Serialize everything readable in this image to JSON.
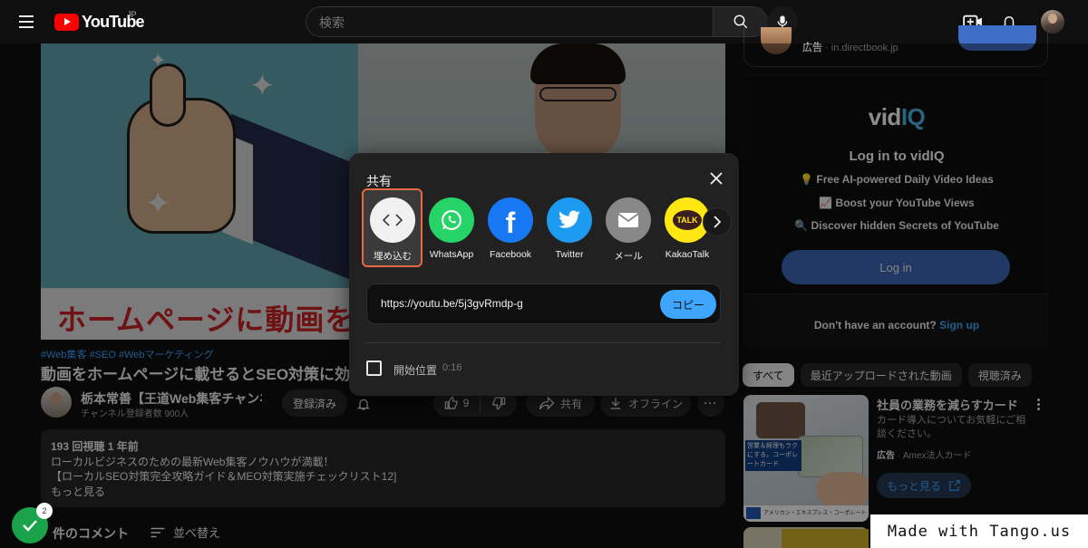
{
  "header": {
    "logo_text": "YouTube",
    "logo_region": "JP",
    "search_placeholder": "検索"
  },
  "video": {
    "banner_text": "ホームページに動画を載せる",
    "hashtags": "#Web集客 #SEO #Webマーケティング",
    "title": "動画をホームページに載せるとSEO対策に効果",
    "channel_name": "栃本常善【王道Web集客チャンネル】",
    "subscribers": "チャンネル登録者数 900人",
    "subscribed_label": "登録済み",
    "like_count": "9",
    "share_label": "共有",
    "offline_label": "オフライン"
  },
  "description": {
    "stats": "193 回視聴  1 年前",
    "line1": "ローカルビジネスのための最新Web集客ノウハウが満載！",
    "line2": "【ローカルSEO対策完全攻略ガイド＆MEO対策実施チェックリスト12]",
    "more": "もっと見る"
  },
  "comments": {
    "count_label": "件のコメント",
    "sort_label": "並べ替え"
  },
  "tango": {
    "badge_count": "2",
    "watermark": "Made with Tango.us"
  },
  "ad_top": {
    "label": "広告",
    "domain": "in.directbook.jp"
  },
  "vidiq": {
    "brand_main": "vid",
    "brand_accent": "IQ",
    "title": "Log in to vidIQ",
    "features": [
      "💡 Free AI-powered Daily Video Ideas",
      "📈 Boost your YouTube Views",
      "🔍 Discover hidden Secrets of YouTube"
    ],
    "login_label": "Log in",
    "no_account": "Don't have an account?",
    "signup": "Sign up"
  },
  "chips": [
    "すべて",
    "最近アップロードされた動画",
    "視聴済み"
  ],
  "ad_side": {
    "title": "社員の業務を減らすカード",
    "desc": "カード導入についてお気軽にご相談ください。",
    "label": "広告",
    "advertiser": "Amex法人カード",
    "cta": "もっと見る",
    "thumb_tag": "営業＆経理もラクにする。コーポレートカード",
    "thumb_footer": "アメリカン・エキスプレス・コーポレート・カード [お気軽にご相談]"
  },
  "share_dialog": {
    "title": "共有",
    "targets": [
      {
        "label": "埋め込む",
        "icon": "embed-icon",
        "color": "#f1f1f1"
      },
      {
        "label": "WhatsApp",
        "icon": "whatsapp-icon",
        "color": "#25d366"
      },
      {
        "label": "Facebook",
        "icon": "facebook-icon",
        "color": "#1877f2"
      },
      {
        "label": "Twitter",
        "icon": "twitter-icon",
        "color": "#1d9bf0"
      },
      {
        "label": "メール",
        "icon": "mail-icon",
        "color": "#888888"
      },
      {
        "label": "KakaoTalk",
        "icon": "kakaotalk-icon",
        "color": "#ffe812"
      }
    ],
    "url": "https://youtu.be/5j3gvRmdp-g",
    "copy_label": "コピー",
    "start_label": "開始位置",
    "start_time": "0:16"
  },
  "colors": {
    "accent_blue": "#3ea6ff",
    "youtube_red": "#ff0000",
    "highlight_orange": "#e8683f"
  }
}
